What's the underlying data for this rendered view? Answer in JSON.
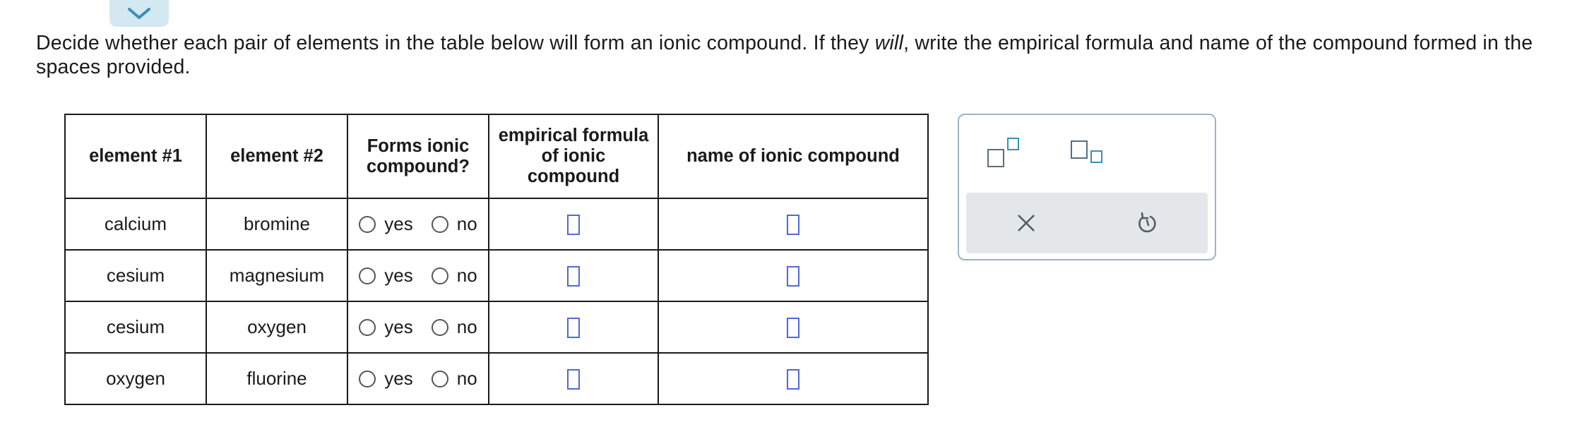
{
  "instructions": {
    "part1": "Decide whether each pair of elements in the table below will form an ionic compound. If they ",
    "emphasis": "will",
    "part2": ", write the empirical formula and name of the compound formed in the spaces provided."
  },
  "table": {
    "headers": {
      "element1": "element #1",
      "element2": "element #2",
      "forms_ionic": "Forms ionic compound?",
      "formula": "empirical formula of ionic compound",
      "name": "name of ionic compound"
    },
    "radio_yes": "yes",
    "radio_no": "no",
    "rows": [
      {
        "element1": "calcium",
        "element2": "bromine"
      },
      {
        "element1": "cesium",
        "element2": "magnesium"
      },
      {
        "element1": "cesium",
        "element2": "oxygen"
      },
      {
        "element1": "oxygen",
        "element2": "fluorine"
      }
    ]
  },
  "tools": {
    "superscript_icon": "superscript-icon",
    "subscript_icon": "subscript-icon",
    "clear_icon": "close-icon",
    "undo_icon": "undo-icon"
  },
  "colors": {
    "answer_box_border": "#4f6ad6",
    "collapse_tab": "#d3e8f0",
    "tool_footer": "#e4e7ea",
    "icon_accent": "#3b8fb3"
  }
}
